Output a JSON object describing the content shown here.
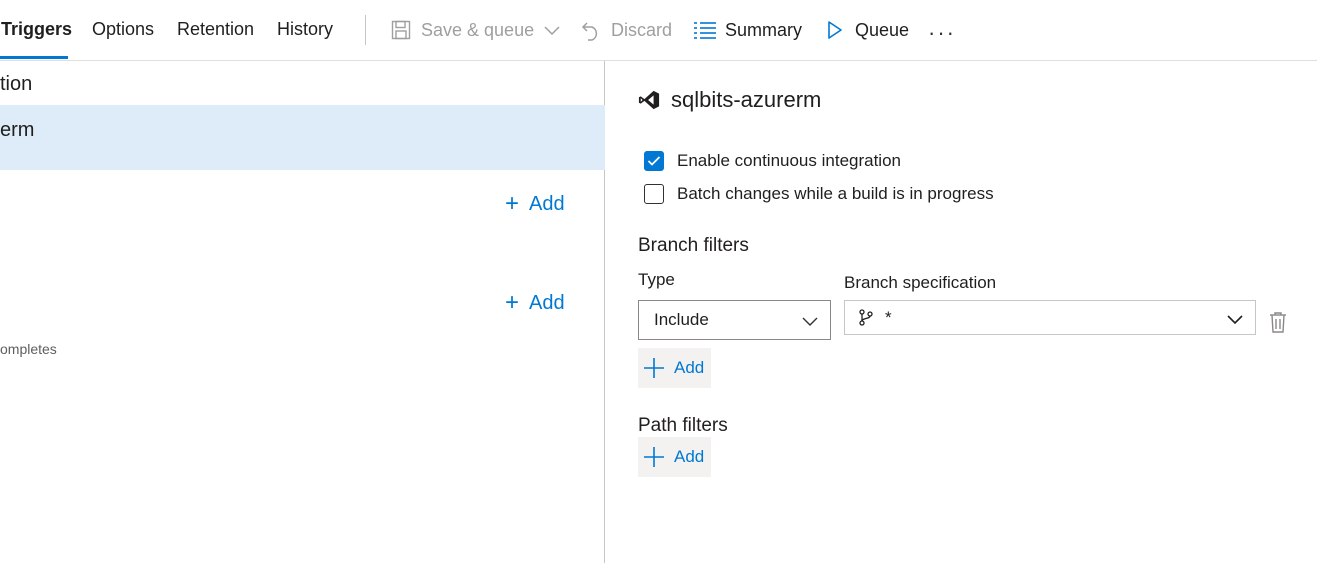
{
  "tabs": [
    {
      "label": "Triggers",
      "active": true
    },
    {
      "label": "Options"
    },
    {
      "label": "Retention"
    },
    {
      "label": "History"
    }
  ],
  "toolbar": {
    "save_queue_label": "Save & queue",
    "discard_label": "Discard",
    "summary_label": "Summary",
    "queue_label": "Queue",
    "more_label": "···"
  },
  "left_panel": {
    "row1_text": "tion",
    "row2_text": "erm",
    "add1_label": "Add",
    "add2_label": "Add",
    "small_text": "ompletes"
  },
  "right_panel": {
    "repo_name": "sqlbits-azurerm",
    "enable_ci_label": "Enable continuous integration",
    "enable_ci_checked": true,
    "batch_label": "Batch changes while a build is in progress",
    "batch_checked": false,
    "branch_filters_title": "Branch filters",
    "type_label": "Type",
    "type_value": "Include",
    "branch_spec_label": "Branch specification",
    "branch_spec_value": "*",
    "branch_add_label": "Add",
    "path_filters_title": "Path filters",
    "path_add_label": "Add"
  },
  "colors": {
    "accent": "#0078d4",
    "selected_row": "#deecf9",
    "disabled": "#a19f9d"
  }
}
